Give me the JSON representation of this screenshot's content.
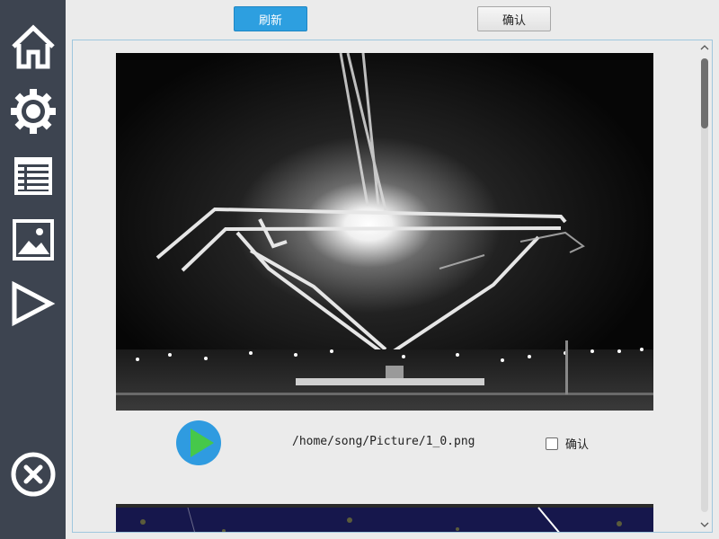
{
  "sidebar": {
    "items": [
      {
        "name": "home",
        "icon": "home-icon"
      },
      {
        "name": "settings",
        "icon": "gear-icon"
      },
      {
        "name": "list",
        "icon": "table-icon"
      },
      {
        "name": "gallery",
        "icon": "image-icon"
      },
      {
        "name": "play",
        "icon": "play-triangle-icon"
      },
      {
        "name": "exit",
        "icon": "close-circle-icon"
      }
    ],
    "color": "#3d4450",
    "icon_color": "#ffffff"
  },
  "toolbar": {
    "refresh_label": "刷新",
    "confirm_label": "确认",
    "refresh_color": "#2d9fe0"
  },
  "gallery": {
    "items": [
      {
        "image_description": "Night-time grayscale camera image of a suspended metal frame with a bright light flare",
        "path": "/home/song/Picture/1_0.png",
        "checkbox_label": "确认",
        "checked": false,
        "play_icon": "play-icon"
      }
    ],
    "next_image_description": "Partially visible dark blue night-time camera image"
  },
  "colors": {
    "panel_border": "#9fc7de",
    "play_button_circle": "#2f9be0",
    "play_button_triangle": "#46c84a"
  }
}
